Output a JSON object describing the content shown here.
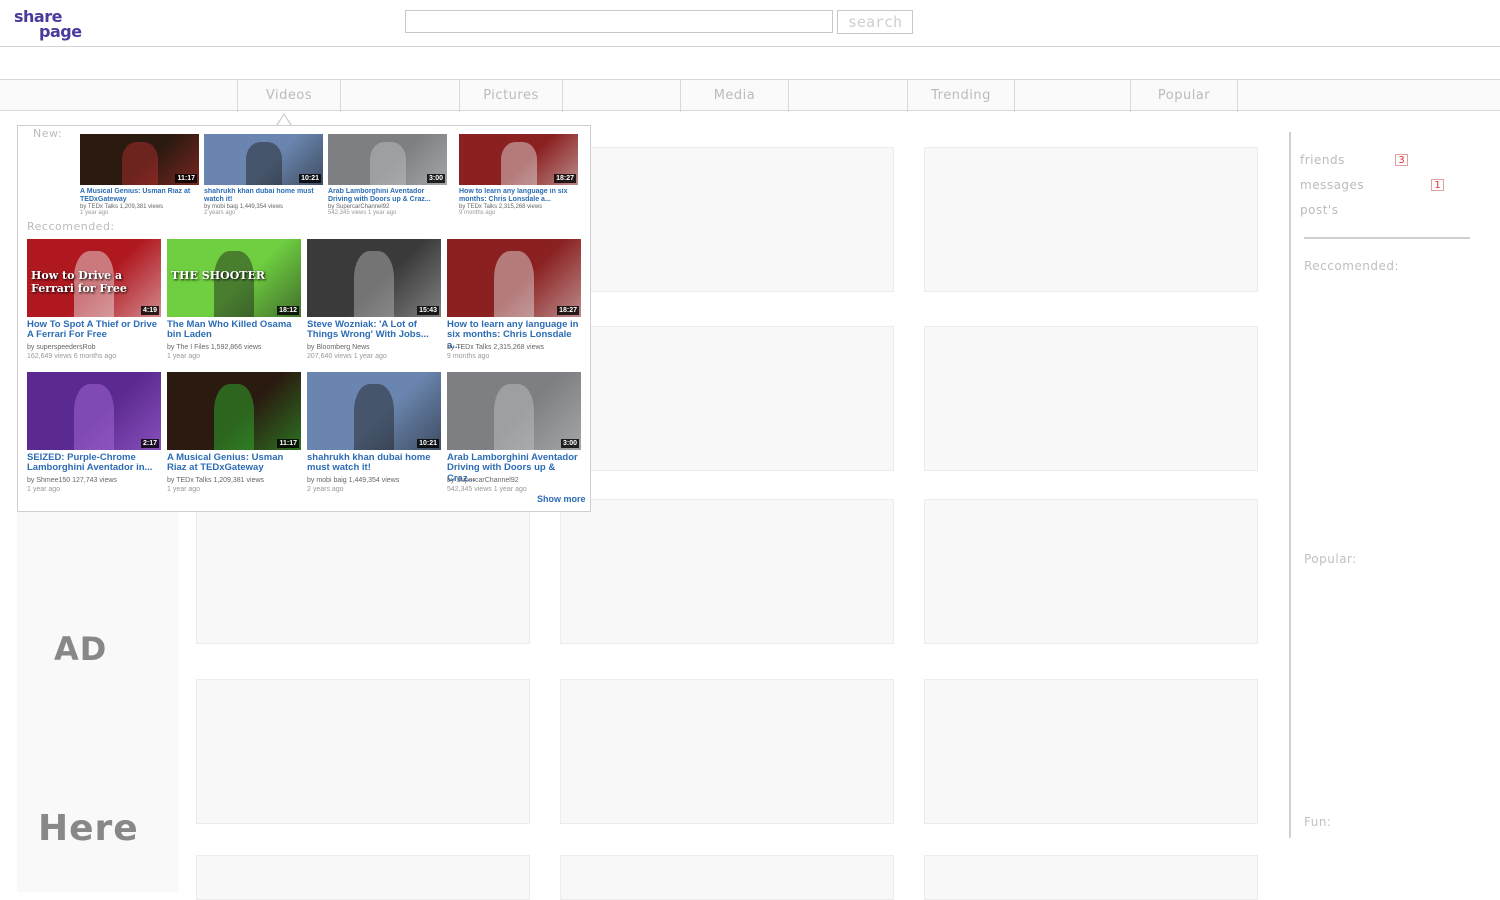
{
  "header": {
    "logo_line1": "share",
    "logo_line2": "page",
    "search_placeholder": "",
    "search_button": "search"
  },
  "nav": {
    "tabs": [
      {
        "label": "Videos"
      },
      {
        "label": "Pictures"
      },
      {
        "label": "Media"
      },
      {
        "label": "Trending"
      },
      {
        "label": "Popular"
      }
    ]
  },
  "ad": {
    "word1": "AD",
    "word2": "Here"
  },
  "sidebar": {
    "links": [
      {
        "label": "friends",
        "badge": "3"
      },
      {
        "label": "messages",
        "badge": "1"
      },
      {
        "label": "post's",
        "badge": ""
      }
    ],
    "sections": [
      {
        "label": "Reccomended:"
      },
      {
        "label": "Popular:"
      },
      {
        "label": "Fun:"
      }
    ]
  },
  "dropdown": {
    "new_label": "New:",
    "recommended_label": "Reccomended:",
    "show_more": "Show more",
    "new_videos": [
      {
        "title": "A Musical Genius: Usman Riaz at TEDxGateway",
        "meta": "by TEDx Talks  1,209,381 views",
        "age": "1 year ago",
        "duration": "11:17",
        "thumb_bg": "#2a1a10",
        "thumb_accent": "#c03030"
      },
      {
        "title": "shahrukh khan dubai home must watch it!",
        "meta": "by mobi baig  1,449,354 views",
        "age": "2 years ago",
        "duration": "10:21",
        "thumb_bg": "#6a86b0",
        "thumb_accent": "#1a1a1a"
      },
      {
        "title": "Arab Lamborghini Aventador Driving with Doors up & Craz...",
        "meta": "by SupercarChannel92",
        "age": "542,345 views  1 year ago",
        "duration": "3:00",
        "thumb_bg": "#7d7f82",
        "thumb_accent": "#c8c8c8"
      },
      {
        "title": "How to learn any language in six months: Chris Lonsdale a...",
        "meta": "by TEDx Talks  2,315,268 views",
        "age": "9 months ago",
        "duration": "18:27",
        "thumb_bg": "#8a2020",
        "thumb_accent": "#e8e8e8"
      }
    ],
    "recommended_videos": [
      {
        "title": "How To Spot A Thief or Drive A Ferrari For Free",
        "meta": "by superspeedersRob",
        "age": "162,649 views  6 months ago",
        "duration": "4:19",
        "thumb_bg": "#b01820",
        "thumb_accent": "#f0f0f0",
        "overlay": "How to Drive a Ferrari for Free"
      },
      {
        "title": "The Man Who Killed Osama bin Laden",
        "meta": "by The I Files  1,592,866 views",
        "age": "1 year ago",
        "duration": "18:12",
        "thumb_bg": "#6fcf40",
        "thumb_accent": "#1a1a1a",
        "overlay": "THE SHOOTER"
      },
      {
        "title": "Steve Wozniak: 'A Lot of Things Wrong' With Jobs...",
        "meta": "by Bloomberg News",
        "age": "207,640 views  1 year ago",
        "duration": "15:43",
        "thumb_bg": "#3a3a3a",
        "thumb_accent": "#bdbdbd",
        "overlay": ""
      },
      {
        "title": "How to learn any language in six months: Chris Lonsdale a...",
        "meta": "by TEDx Talks  2,315,268 views",
        "age": "9 months ago",
        "duration": "18:27",
        "thumb_bg": "#8a2020",
        "thumb_accent": "#e8e8e8",
        "overlay": ""
      },
      {
        "title": "SEIZED: Purple-Chrome Lamborghini Aventador in...",
        "meta": "by Shmee150  127,743 views",
        "age": "1 year ago",
        "duration": "2:17",
        "thumb_bg": "#5a2a90",
        "thumb_accent": "#b070e0",
        "overlay": ""
      },
      {
        "title": "A Musical Genius: Usman Riaz at TEDxGateway",
        "meta": "by TEDx Talks  1,209,381 views",
        "age": "1 year ago",
        "duration": "11:17",
        "thumb_bg": "#2a1a10",
        "thumb_accent": "#30c030",
        "overlay": ""
      },
      {
        "title": "shahrukh khan dubai home must watch it!",
        "meta": "by mobi baig  1,449,354 views",
        "age": "2 years ago",
        "duration": "10:21",
        "thumb_bg": "#6a86b0",
        "thumb_accent": "#1a1a1a",
        "overlay": ""
      },
      {
        "title": "Arab Lamborghini Aventador Driving with Doors up & Craz...",
        "meta": "by SupercarChannel92",
        "age": "542,345 views  1 year ago",
        "duration": "3:00",
        "thumb_bg": "#7d7f82",
        "thumb_accent": "#c8c8c8",
        "overlay": ""
      }
    ]
  }
}
